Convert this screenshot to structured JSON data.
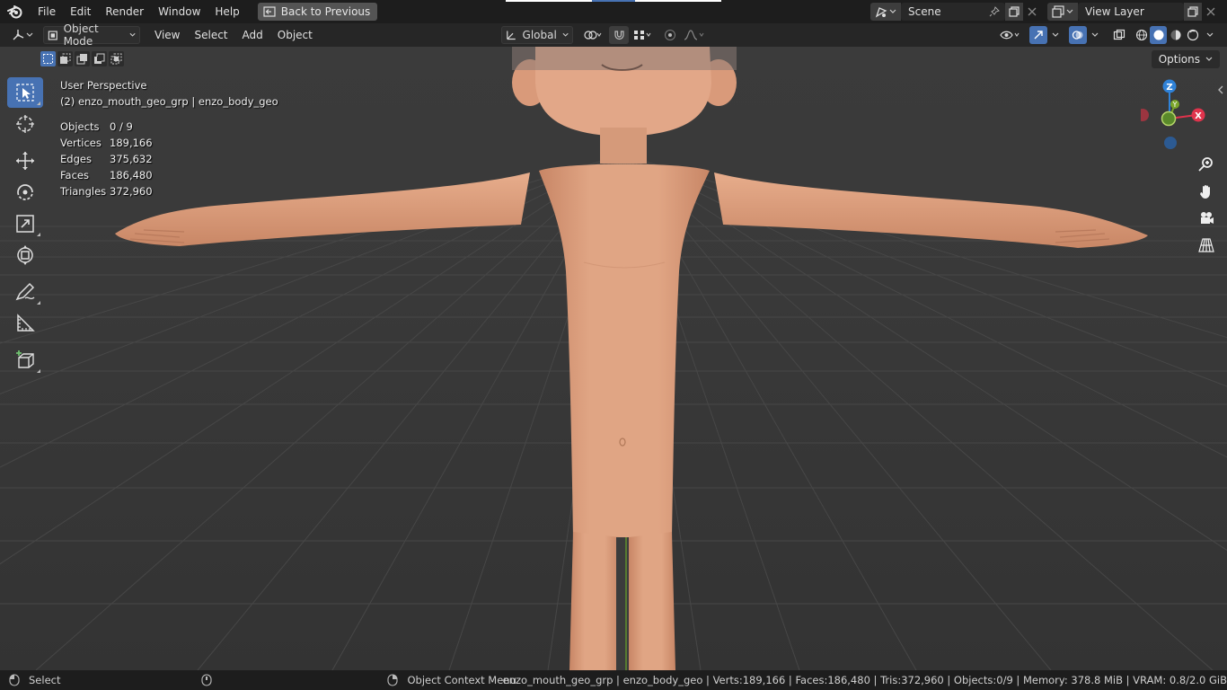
{
  "menu": {
    "items": [
      "File",
      "Edit",
      "Render",
      "Window",
      "Help"
    ],
    "back_to_previous": "Back to Previous"
  },
  "scene": {
    "label": "Scene"
  },
  "view_layer": {
    "label": "View Layer"
  },
  "header": {
    "mode": "Object Mode",
    "menus": [
      "View",
      "Select",
      "Add",
      "Object"
    ],
    "transform_orientation": "Global"
  },
  "viewport": {
    "view_name": "User Perspective",
    "active_object": "(2) enzo_mouth_geo_grp | enzo_body_geo",
    "stats": [
      {
        "label": "Objects",
        "value": "0 / 9"
      },
      {
        "label": "Vertices",
        "value": "189,166"
      },
      {
        "label": "Edges",
        "value": "375,632"
      },
      {
        "label": "Faces",
        "value": "186,480"
      },
      {
        "label": "Triangles",
        "value": "372,960"
      }
    ],
    "options_label": "Options",
    "gizmo": {
      "z": "Z",
      "x": "X",
      "y": "Y"
    }
  },
  "statusbar": {
    "select": "Select",
    "context_menu": "Object Context Menu",
    "info": "enzo_mouth_geo_grp | enzo_body_geo | Verts:189,166 | Faces:186,480 | Tris:372,960 | Objects:0/9 | Memory: 378.8 MiB | VRAM: 0.8/2.0 GiB"
  },
  "colors": {
    "accent": "#4772b3",
    "axis_x": "#e0334c",
    "axis_y": "#7ba52a",
    "axis_z": "#2f82d8",
    "skin": "#e2a682"
  }
}
